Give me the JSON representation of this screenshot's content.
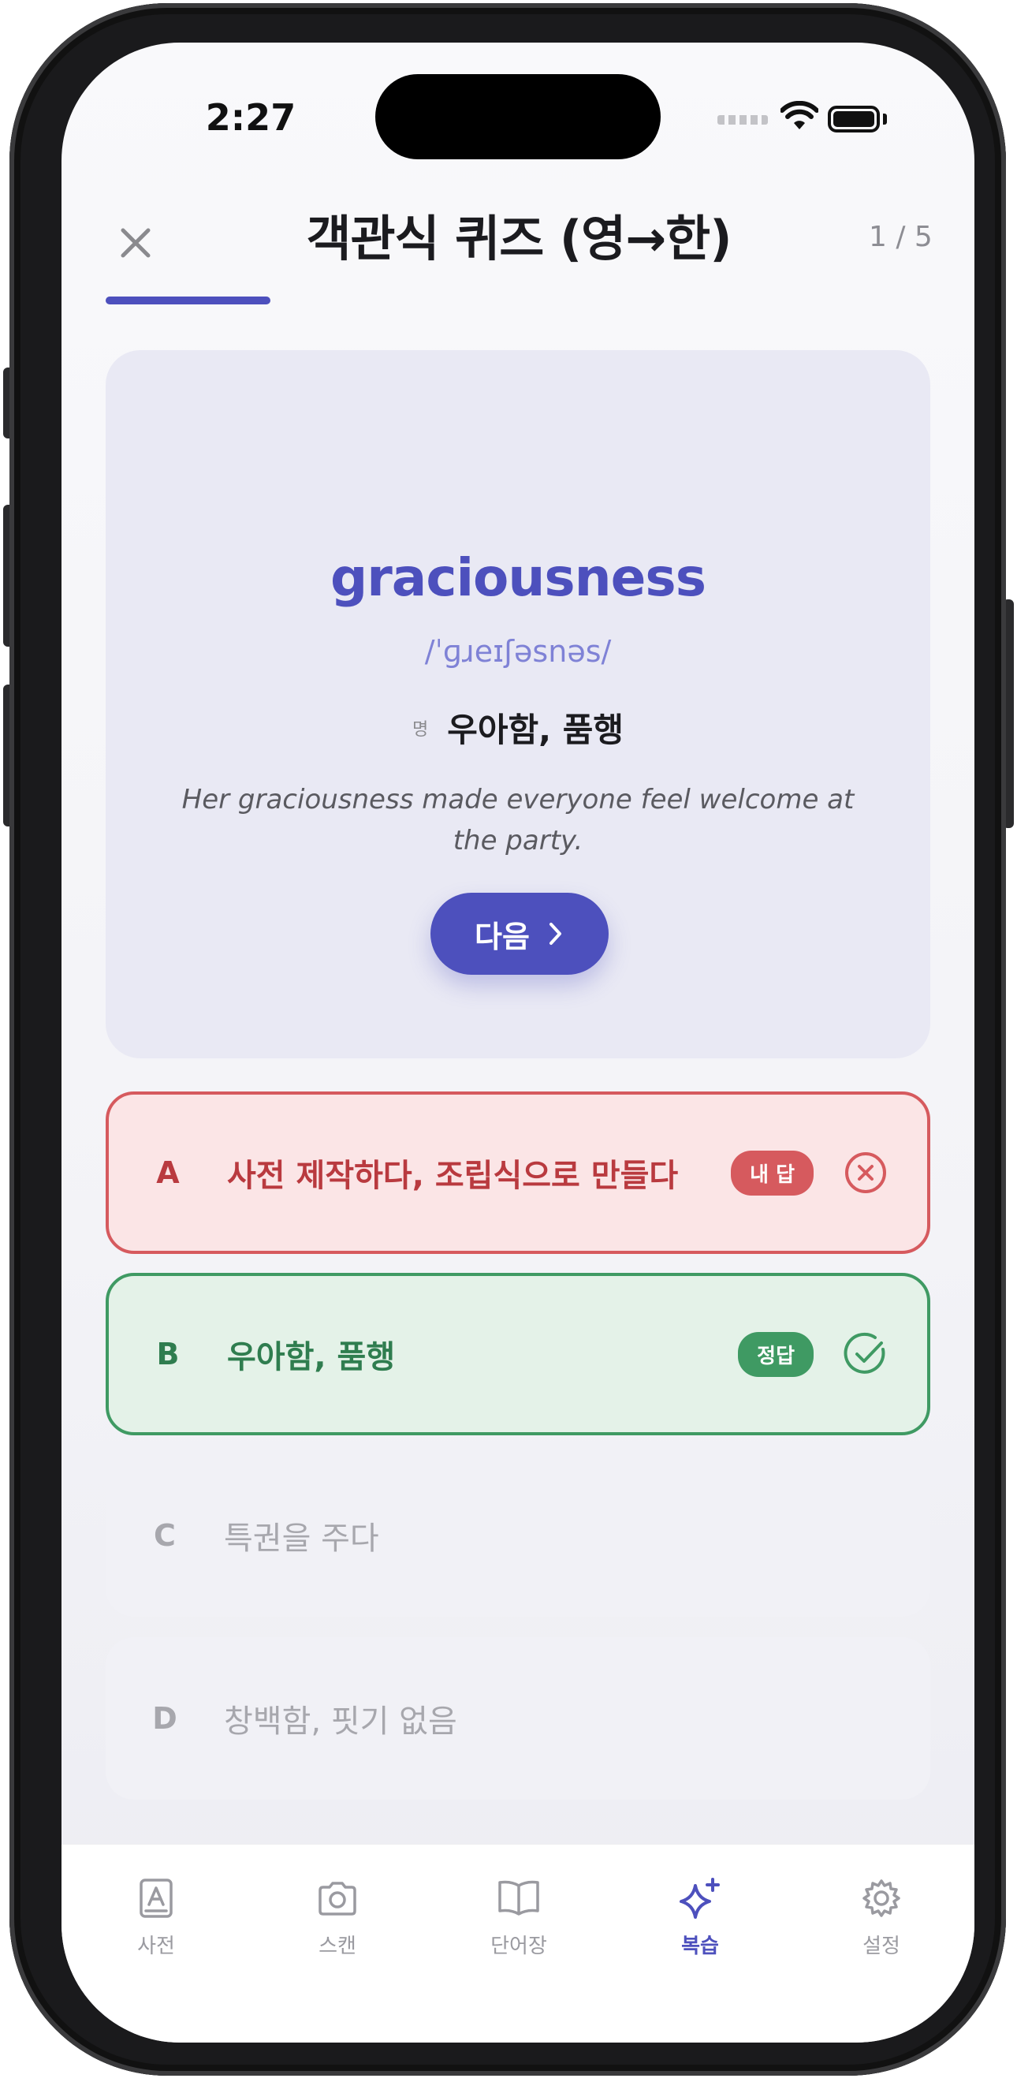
{
  "status": {
    "time": "2:27"
  },
  "header": {
    "title": "객관식 퀴즈 (영→한)",
    "counter": "1 / 5",
    "progress": 0.2
  },
  "card": {
    "word": "graciousness",
    "phonetic": "/ˈɡɹeɪʃəsnəs/",
    "pos": "명",
    "meaning": "우아함, 품행",
    "example": "Her graciousness made everyone feel welcome at the party.",
    "next_label": "다음"
  },
  "options": [
    {
      "letter": "A",
      "text": "사전 제작하다, 조립식으로 만들다",
      "badge": "내 답",
      "state": "wrong",
      "icon": "x-circle-icon"
    },
    {
      "letter": "B",
      "text": "우아함, 품행",
      "badge": "정답",
      "state": "correct",
      "icon": "check-circle-icon"
    },
    {
      "letter": "C",
      "text": "특권을 주다",
      "state": "neutral"
    },
    {
      "letter": "D",
      "text": "창백함, 핏기 없음",
      "state": "neutral"
    }
  ],
  "tabs": [
    {
      "label": "사전",
      "icon": "dictionary-icon",
      "active": false
    },
    {
      "label": "스캔",
      "icon": "camera-icon",
      "active": false
    },
    {
      "label": "단어장",
      "icon": "book-icon",
      "active": false
    },
    {
      "label": "복습",
      "icon": "sparkles-icon",
      "active": true
    },
    {
      "label": "설정",
      "icon": "gear-icon",
      "active": false
    }
  ],
  "colors": {
    "accent": "#4d50bd",
    "wrong": "#d65a5e",
    "correct": "#3f9a63"
  }
}
